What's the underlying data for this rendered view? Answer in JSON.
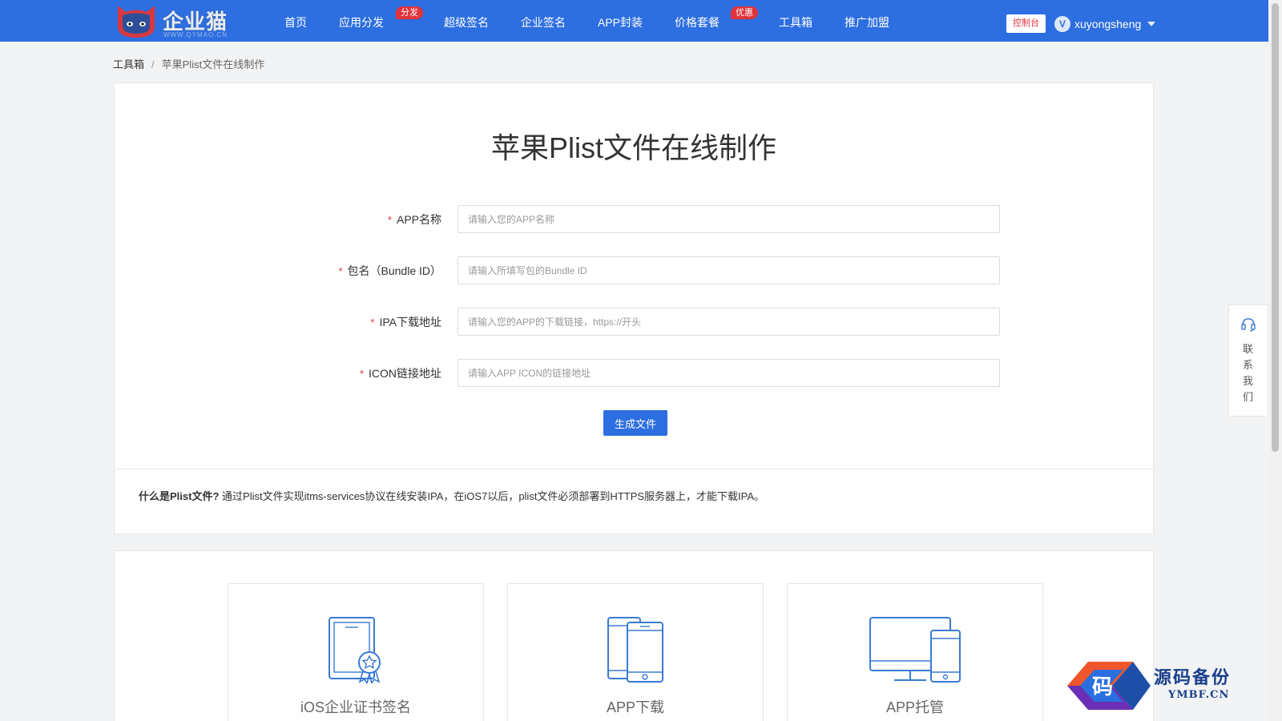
{
  "header": {
    "logo": {
      "text": "企业猫",
      "sub": "WWW.QYMAO.CN"
    },
    "nav": [
      {
        "label": "首页",
        "badge": ""
      },
      {
        "label": "应用分发",
        "badge": "分发"
      },
      {
        "label": "超级签名",
        "badge": ""
      },
      {
        "label": "企业签名",
        "badge": ""
      },
      {
        "label": "APP封装",
        "badge": ""
      },
      {
        "label": "价格套餐",
        "badge": "优惠"
      },
      {
        "label": "工具箱",
        "badge": ""
      },
      {
        "label": "推广加盟",
        "badge": ""
      }
    ],
    "console_label": "控制台",
    "user": {
      "avatar_letter": "V",
      "name": "xuyongsheng"
    }
  },
  "breadcrumb": {
    "parent": "工具箱",
    "separator": "/",
    "current": "苹果Plist文件在线制作"
  },
  "main": {
    "title": "苹果Plist文件在线制作",
    "form": [
      {
        "label": "APP名称",
        "placeholder": "请输入您的APP名称"
      },
      {
        "label": "包名（Bundle ID）",
        "placeholder": "请输入所填写包的Bundle ID"
      },
      {
        "label": "IPA下载地址",
        "placeholder": "请输入您的APP的下载链接，https://开头"
      },
      {
        "label": "ICON链接地址",
        "placeholder": "请输入APP ICON的链接地址"
      }
    ],
    "required_mark": "*",
    "submit_label": "生成文件",
    "note_title": "什么是Plist文件?",
    "note_text": "通过Plist文件实现itms-services协议在线安装IPA，在iOS7以后，plist文件必须部署到HTTPS服务器上，才能下载IPA。"
  },
  "features": [
    {
      "label": "iOS企业证书签名",
      "icon": "certificate-tablet-icon"
    },
    {
      "label": "APP下载",
      "icon": "phones-icon"
    },
    {
      "label": "APP托管",
      "icon": "devices-icon"
    }
  ],
  "contact": {
    "text_lines": [
      "联",
      "系",
      "我",
      "们"
    ],
    "icon": "headset-icon"
  },
  "watermark": {
    "title": "源码备份",
    "sub": "YMBF.CN",
    "mark": "码"
  },
  "colors": {
    "primary": "#2d6ee0",
    "badge": "#e2323a",
    "background": "#f2f3f5"
  }
}
